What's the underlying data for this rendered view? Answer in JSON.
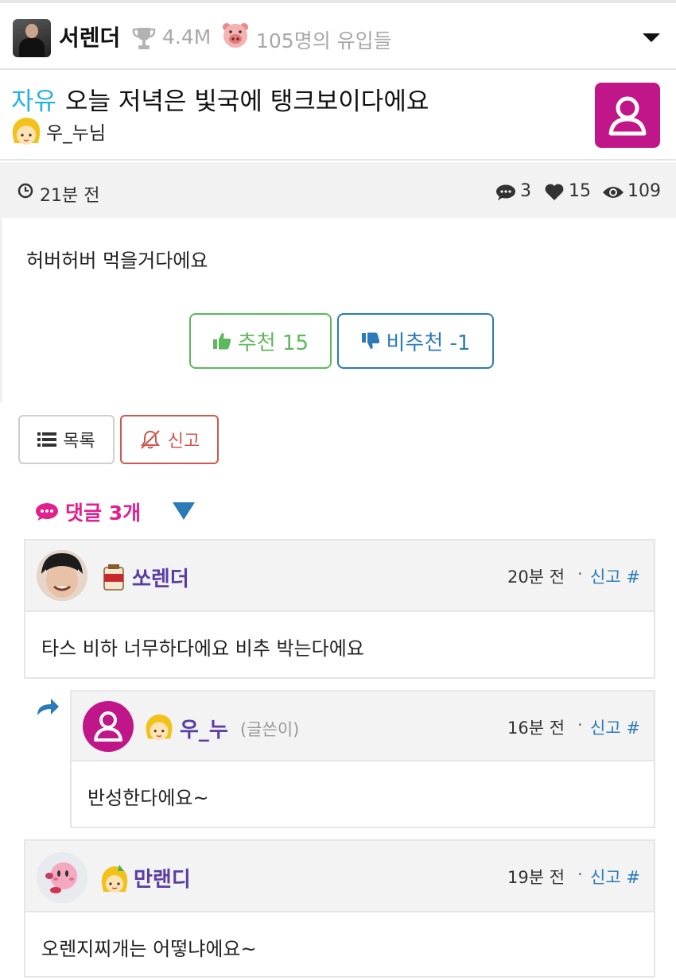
{
  "channel": {
    "name": "서렌더",
    "score": "4.4M",
    "inflow": "105명의 유입들"
  },
  "post": {
    "category": "자유",
    "title": "오늘 저녁은 빛국에 탱크보이다에요",
    "author": "우_누님",
    "time": "21분 전",
    "comments": "3",
    "likes": "15",
    "views": "109",
    "body": "허버허버 먹을거다에요"
  },
  "actions": {
    "upvote_label": "추천 15",
    "downvote_label": "비추천 -1",
    "list_label": "목록",
    "report_label": "신고"
  },
  "comments_header": "댓글 3개",
  "comments": [
    {
      "name": "쏘렌더",
      "time": "20분 전",
      "dot": "·",
      "report": "신고 #",
      "text": "타스 비하 너무하다에요 비추 박는다에요"
    },
    {
      "name": "우_누",
      "writer": "(글쓴이)",
      "time": "16분 전",
      "dot": "·",
      "report": "신고 #",
      "text": "반성한다에요~"
    },
    {
      "name": "만랜디",
      "time": "19분 전",
      "dot": "·",
      "report": "신고 #",
      "text": "오렌지찌개는 어떻냐에요~"
    }
  ],
  "colors": {
    "category": "#27b0e6",
    "upvote": "#5cb85c",
    "downvote": "#2a7bb8",
    "report": "#d0584e",
    "comment_header": "#e0208f",
    "username": "#5a3ea3",
    "default_avatar": "#c0168a"
  }
}
